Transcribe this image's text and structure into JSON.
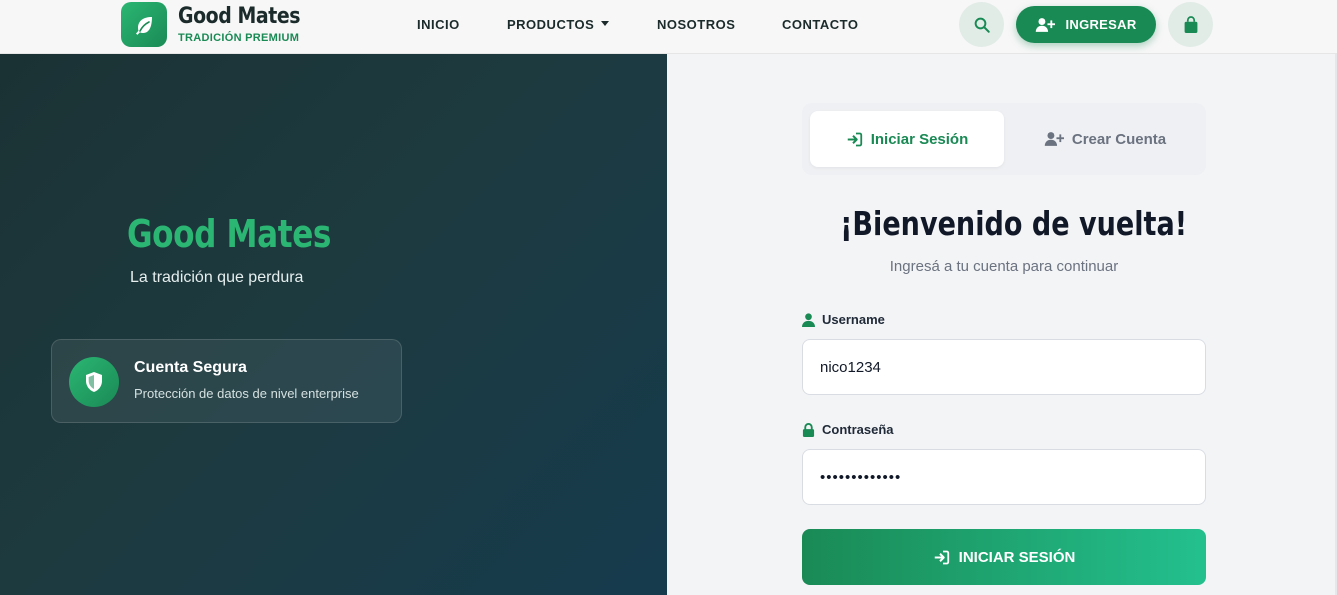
{
  "brand": {
    "name": "Good Mates",
    "tagline": "TRADICIÓN PREMIUM"
  },
  "nav": {
    "links": [
      "INICIO",
      "PRODUCTOS",
      "NOSOTROS",
      "CONTACTO"
    ],
    "login_button": "INGRESAR"
  },
  "hero": {
    "title": "Good Mates",
    "subtitle": "La tradición que perdura",
    "feature": {
      "title": "Cuenta Segura",
      "description": "Protección de datos de nivel enterprise"
    }
  },
  "auth": {
    "tabs": {
      "login": "Iniciar Sesión",
      "register": "Crear Cuenta"
    },
    "heading": "¡Bienvenido de vuelta!",
    "subheading": "Ingresá a tu cuenta para continuar",
    "username": {
      "label": "Username",
      "value": "nico1234"
    },
    "password": {
      "label": "Contraseña",
      "value": "•••••••••••••"
    },
    "submit": "INICIAR SESIÓN"
  },
  "colors": {
    "brand_green": "#1a8a55",
    "accent_green": "#2bb673",
    "dark_panel": "#1b3234"
  },
  "icons": [
    "leaf-icon",
    "search-icon",
    "user-plus-icon",
    "shopping-bag-icon",
    "shield-icon",
    "sign-in-icon",
    "user-icon",
    "lock-icon"
  ]
}
